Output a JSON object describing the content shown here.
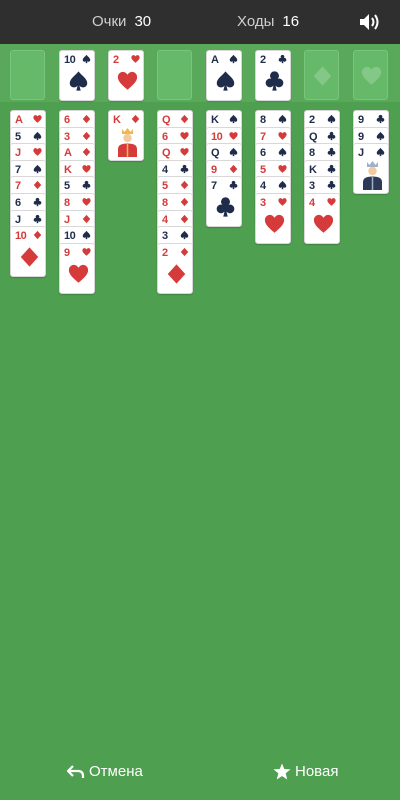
{
  "score": {
    "label": "Очки",
    "value": "30"
  },
  "moves": {
    "label": "Ходы",
    "value": "16"
  },
  "colors": {
    "red": "#d63b3b",
    "black": "#1f2c4a",
    "felt": "#4f9f50"
  },
  "freecells": [
    {
      "rank": "",
      "suit": ""
    },
    {
      "rank": "10",
      "suit": "spade"
    },
    {
      "rank": "2",
      "suit": "heart"
    },
    {
      "rank": "",
      "suit": ""
    }
  ],
  "foundations": [
    {
      "rank": "A",
      "suit": "spade"
    },
    {
      "rank": "2",
      "suit": "club"
    },
    {
      "rank": "",
      "suit": "diamond"
    },
    {
      "rank": "",
      "suit": "heart"
    }
  ],
  "tableau": [
    [
      {
        "rank": "A",
        "suit": "heart"
      },
      {
        "rank": "5",
        "suit": "spade"
      },
      {
        "rank": "J",
        "suit": "heart"
      },
      {
        "rank": "7",
        "suit": "spade"
      },
      {
        "rank": "7",
        "suit": "diamond"
      },
      {
        "rank": "6",
        "suit": "club"
      },
      {
        "rank": "J",
        "suit": "club"
      },
      {
        "rank": "10",
        "suit": "diamond"
      }
    ],
    [
      {
        "rank": "6",
        "suit": "diamond"
      },
      {
        "rank": "3",
        "suit": "diamond"
      },
      {
        "rank": "A",
        "suit": "diamond"
      },
      {
        "rank": "K",
        "suit": "heart"
      },
      {
        "rank": "5",
        "suit": "club"
      },
      {
        "rank": "8",
        "suit": "heart"
      },
      {
        "rank": "J",
        "suit": "diamond"
      },
      {
        "rank": "10",
        "suit": "spade"
      },
      {
        "rank": "9",
        "suit": "heart"
      }
    ],
    [
      {
        "rank": "K",
        "suit": "diamond"
      }
    ],
    [
      {
        "rank": "Q",
        "suit": "diamond"
      },
      {
        "rank": "6",
        "suit": "heart"
      },
      {
        "rank": "Q",
        "suit": "heart"
      },
      {
        "rank": "4",
        "suit": "club"
      },
      {
        "rank": "5",
        "suit": "diamond"
      },
      {
        "rank": "8",
        "suit": "diamond"
      },
      {
        "rank": "4",
        "suit": "diamond"
      },
      {
        "rank": "3",
        "suit": "spade"
      },
      {
        "rank": "2",
        "suit": "diamond"
      }
    ],
    [
      {
        "rank": "K",
        "suit": "spade"
      },
      {
        "rank": "10",
        "suit": "heart"
      },
      {
        "rank": "Q",
        "suit": "spade"
      },
      {
        "rank": "9",
        "suit": "diamond"
      },
      {
        "rank": "7",
        "suit": "club"
      }
    ],
    [
      {
        "rank": "8",
        "suit": "spade"
      },
      {
        "rank": "7",
        "suit": "heart"
      },
      {
        "rank": "6",
        "suit": "spade"
      },
      {
        "rank": "5",
        "suit": "heart"
      },
      {
        "rank": "4",
        "suit": "spade"
      },
      {
        "rank": "3",
        "suit": "heart"
      }
    ],
    [
      {
        "rank": "2",
        "suit": "spade"
      },
      {
        "rank": "Q",
        "suit": "club"
      },
      {
        "rank": "8",
        "suit": "club"
      },
      {
        "rank": "K",
        "suit": "club"
      },
      {
        "rank": "3",
        "suit": "club"
      },
      {
        "rank": "4",
        "suit": "heart"
      }
    ],
    [
      {
        "rank": "9",
        "suit": "club"
      },
      {
        "rank": "9",
        "suit": "spade"
      },
      {
        "rank": "J",
        "suit": "spade"
      }
    ]
  ],
  "buttons": {
    "undo": "Отмена",
    "new": "Новая"
  },
  "icons": {
    "sound": "speaker-icon",
    "undo": "undo-arrow-icon",
    "new": "star-icon"
  }
}
